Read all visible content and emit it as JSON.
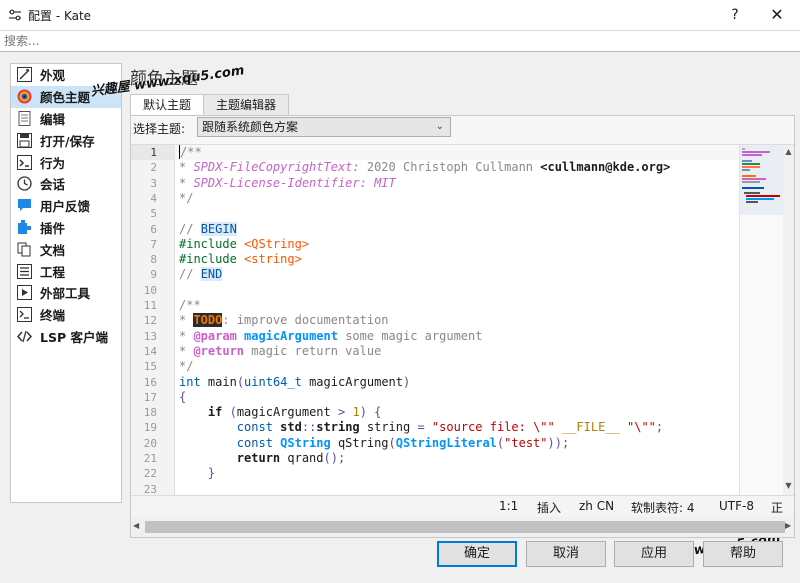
{
  "window": {
    "title": "配置 - Kate",
    "help_glyph": "?",
    "close_glyph": "✕"
  },
  "search": {
    "placeholder": "搜索..."
  },
  "sidebar": {
    "items": [
      {
        "label": "外观",
        "icon": "appearance-icon"
      },
      {
        "label": "颜色主题",
        "icon": "color-theme-icon"
      },
      {
        "label": "编辑",
        "icon": "edit-icon"
      },
      {
        "label": "打开/保存",
        "icon": "save-icon"
      },
      {
        "label": "行为",
        "icon": "behavior-icon"
      },
      {
        "label": "会话",
        "icon": "session-clock-icon"
      },
      {
        "label": "用户反馈",
        "icon": "feedback-icon"
      },
      {
        "label": "插件",
        "icon": "plugin-icon"
      },
      {
        "label": "文档",
        "icon": "documents-icon"
      },
      {
        "label": "工程",
        "icon": "project-icon"
      },
      {
        "label": "外部工具",
        "icon": "external-tools-icon"
      },
      {
        "label": "终端",
        "icon": "terminal-icon"
      },
      {
        "label": "LSP 客户端",
        "icon": "lsp-icon"
      }
    ],
    "active_index": 1
  },
  "page": {
    "title": "颜色主题",
    "watermark": "兴趣屋 www.xqu5.com"
  },
  "tabs": [
    {
      "label": "默认主题"
    },
    {
      "label": "主题编辑器"
    }
  ],
  "theme_select": {
    "label": "选择主题:",
    "value": "跟随系统颜色方案"
  },
  "editor": {
    "line_numbers": [
      "1",
      "2",
      "3",
      "4",
      "5",
      "6",
      "7",
      "8",
      "9",
      "10",
      "11",
      "12",
      "13",
      "14",
      "15",
      "16",
      "17",
      "18",
      "19",
      "20",
      "21",
      "22",
      "23"
    ],
    "current_line": 1
  },
  "status": {
    "position": "1:1",
    "mode": "插入",
    "language": "zh CN",
    "indent": "软制表符: 4",
    "encoding": "UTF-8",
    "extra": "正"
  },
  "buttons": {
    "ok": "确定",
    "cancel": "取消",
    "apply": "应用",
    "help": "帮助"
  },
  "colors": {
    "accent": "#0078d7",
    "selection": "#cce4f7"
  }
}
